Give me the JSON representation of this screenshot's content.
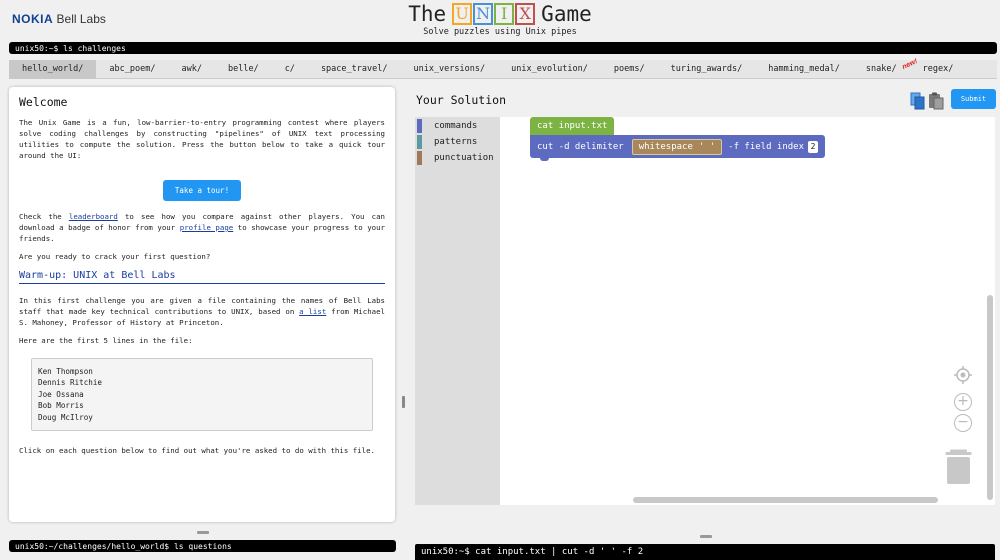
{
  "header": {
    "brand": "NOKIA",
    "labs": "Bell Labs",
    "title_pre": "The",
    "title_letters": [
      "U",
      "N",
      "I",
      "X"
    ],
    "title_letter_colors": [
      "#f5a623",
      "#4a90d9",
      "#7cb342",
      "#c0504d"
    ],
    "title_post": "Game",
    "subtitle": "Solve puzzles using Unix pipes"
  },
  "top_terminal": "unix50:~$ ls challenges",
  "tabs": [
    {
      "label": "hello_world/",
      "active": true
    },
    {
      "label": "abc_poem/"
    },
    {
      "label": "awk/"
    },
    {
      "label": "belle/"
    },
    {
      "label": "c/"
    },
    {
      "label": "space_travel/"
    },
    {
      "label": "unix_versions/"
    },
    {
      "label": "unix_evolution/"
    },
    {
      "label": "poems/"
    },
    {
      "label": "turing_awards/"
    },
    {
      "label": "hamming_medal/"
    },
    {
      "label": "snake/"
    },
    {
      "label": "regex/",
      "badge": "new!"
    }
  ],
  "left": {
    "title": "Welcome",
    "intro": "The Unix Game is a fun, low-barrier-to-entry programming contest where players solve coding challenges by constructing \"pipelines\" of UNIX text processing utilities to compute the solution. Press the button below to take a quick tour around the UI:",
    "tour_button": "Take a tour!",
    "check_pre": "Check the ",
    "leaderboard_link": "leaderboard",
    "check_mid": " to see how you compare against other players. You can download a badge of honor from your ",
    "profile_link": "profile page",
    "check_post": " to showcase your progress to your friends.",
    "ready": "Are you ready to crack your first question?",
    "warmup_title": "Warm-up: UNIX at Bell Labs",
    "challenge_pre": "In this first challenge you are given a file containing the names of Bell Labs staff that made key technical contributions to UNIX, based on ",
    "list_link": "a list",
    "challenge_post": " from Michael S. Mahoney, Professor of History at Princeton.",
    "first_lines_intro": "Here are the first 5 lines in the file:",
    "names": [
      "Ken Thompson",
      "Dennis Ritchie",
      "Joe Ossana",
      "Bob Morris",
      "Doug McIlroy"
    ],
    "outro": "Click on each question below to find out what you're asked to do with this file."
  },
  "bottom_left_terminal": "unix50:~/challenges/hello_world$ ls questions",
  "right": {
    "title": "Your Solution",
    "submit": "Submit",
    "categories": [
      {
        "label": "commands",
        "color": "#5c6bc0"
      },
      {
        "label": "patterns",
        "color": "#5b9aa0"
      },
      {
        "label": "punctuation",
        "color": "#a0785a"
      }
    ],
    "block_cat": "cat input.txt",
    "block_cut_pre": "cut -d delimiter",
    "block_ws_label": "whitespace",
    "block_ws_value": "' '",
    "block_cut_post": "-f field index",
    "block_field_value": "2",
    "zoom_in": "+",
    "zoom_out": "−"
  },
  "bottom_right_terminal": "unix50:~$ cat input.txt | cut -d ' ' -f 2"
}
